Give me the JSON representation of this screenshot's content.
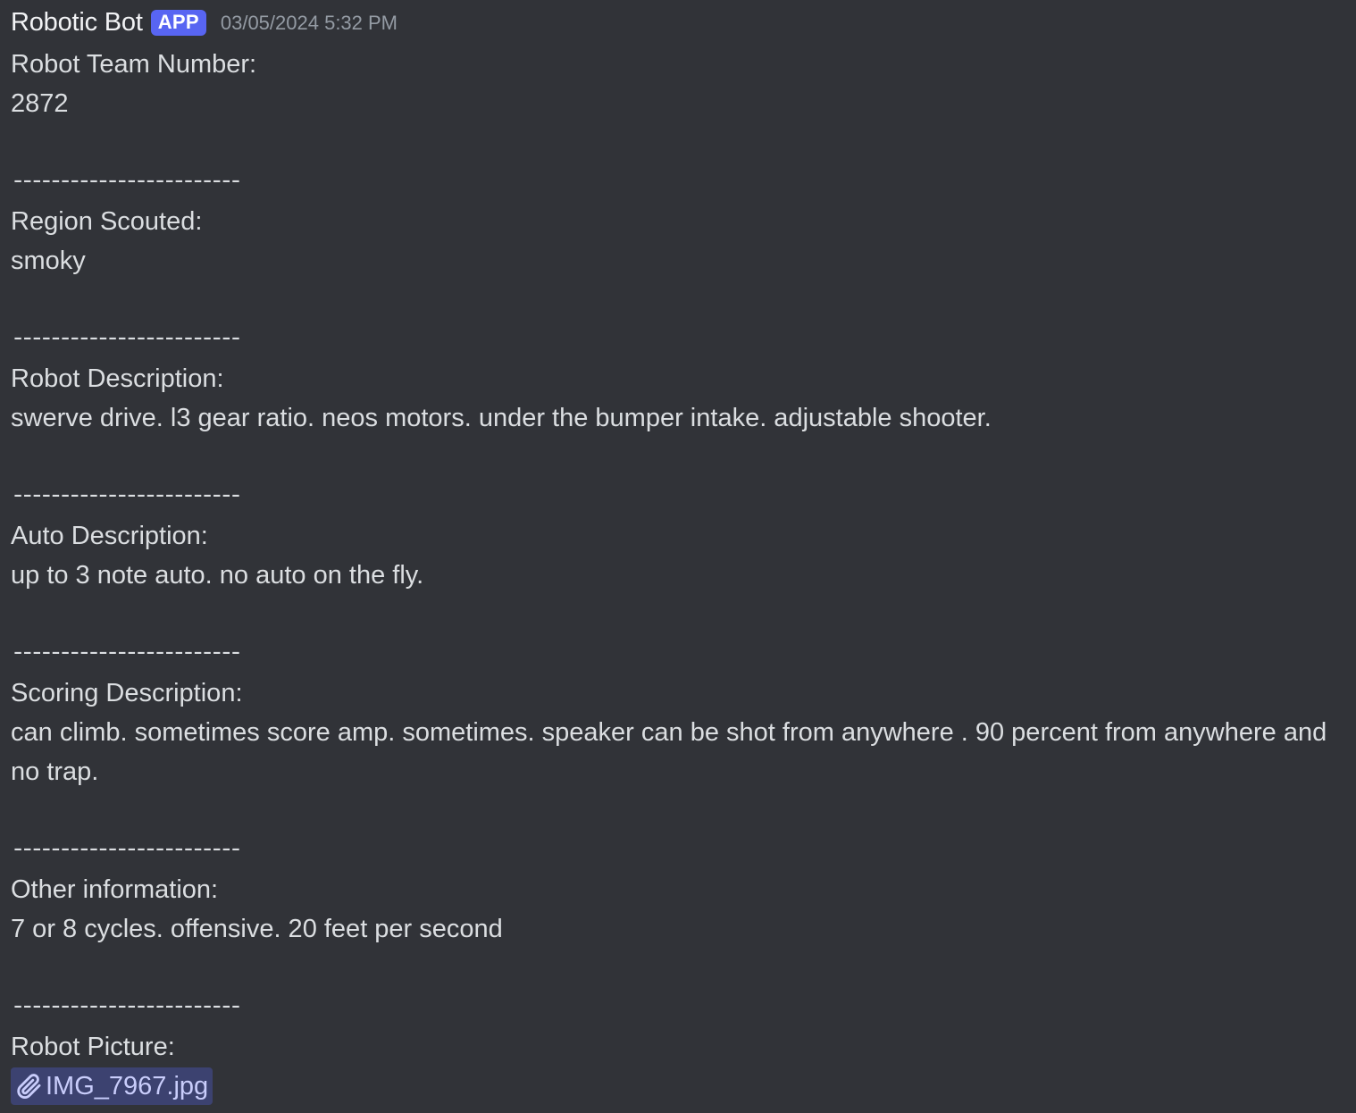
{
  "message": {
    "author": "Robotic Bot",
    "badge": "APP",
    "timestamp": "03/05/2024 5:32 PM",
    "separator": "------------------------",
    "sections": [
      {
        "label": "Robot Team Number:",
        "value": "2872"
      },
      {
        "label": "Region Scouted:",
        "value": "smoky"
      },
      {
        "label": "Robot Description:",
        "value": "swerve drive. l3 gear ratio. neos motors. under the bumper intake. adjustable shooter."
      },
      {
        "label": "Auto Description:",
        "value": "up to 3 note auto. no auto on the fly."
      },
      {
        "label": "Scoring Description:",
        "value": "can climb. sometimes score amp. sometimes. speaker can be shot from anywhere . 90 percent from anywhere and no trap."
      },
      {
        "label": "Other information:",
        "value": "7 or 8 cycles. offensive. 20 feet per second"
      },
      {
        "label": "Robot Picture:"
      }
    ],
    "attachment": {
      "icon": "paperclip-icon",
      "filename": "IMG_7967.jpg"
    }
  },
  "colors": {
    "background": "#313338",
    "text": "#dbdee1",
    "badge": "#5865f2",
    "timestamp": "#949ba4",
    "attachment_bg": "#3c4270",
    "attachment_text": "#c9cdfb"
  }
}
